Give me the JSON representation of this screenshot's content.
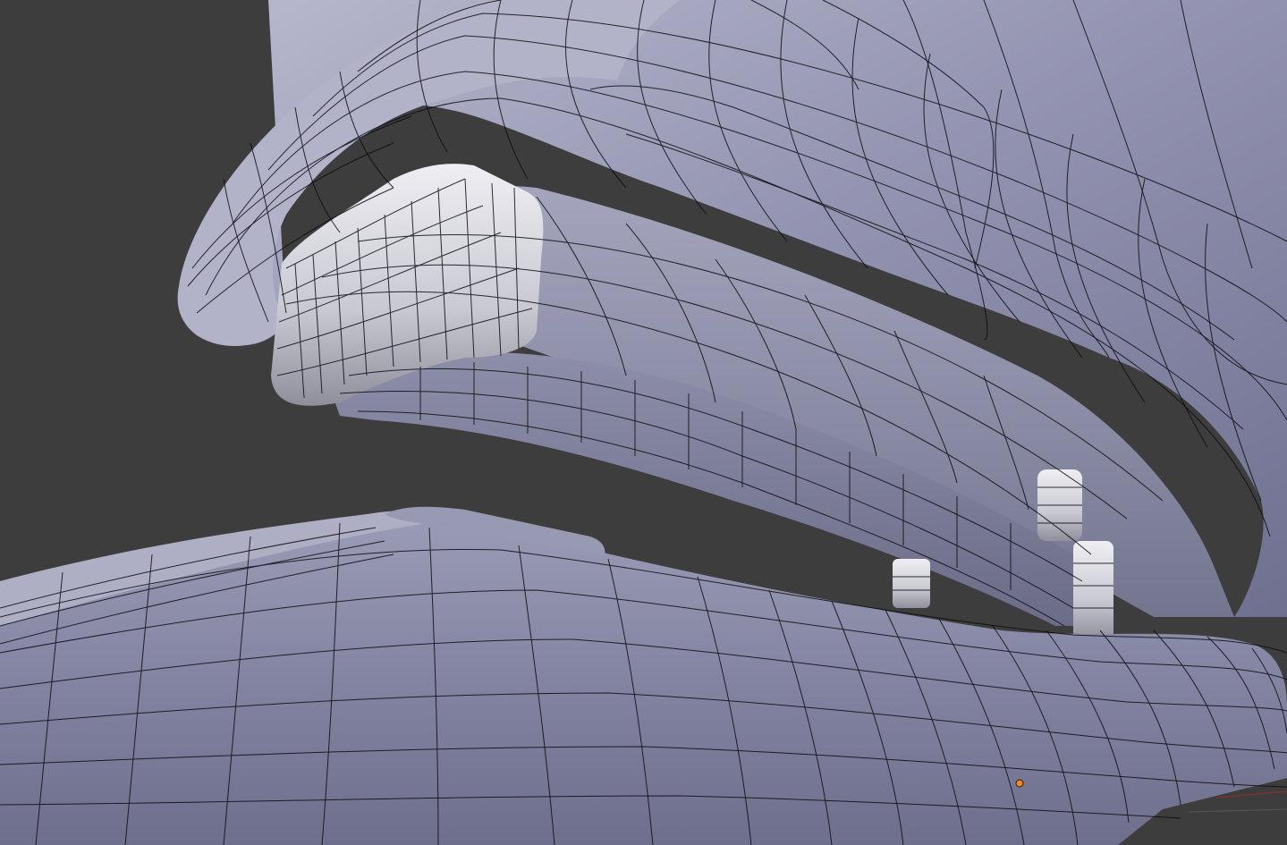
{
  "viewport": {
    "background_color": "#3d3d3d",
    "mesh_color": "#8b8ca8",
    "mesh_highlight": "#c4c5d6",
    "mesh_shadow": "#5a5b72",
    "wire_color": "#0b0b10",
    "origin_dot_color": "#f08a1c",
    "grid_line_color": "#7a3333",
    "shading": "solid-with-wireframe-overlay",
    "object_icon": "stapler-mesh"
  }
}
